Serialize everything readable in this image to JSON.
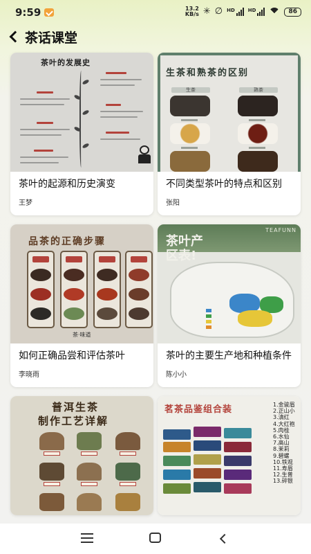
{
  "status_bar": {
    "time": "9:59",
    "net_speed_value": "13.2",
    "net_speed_unit": "KB/s",
    "signal_label_1": "HD",
    "signal_label_2": "HD",
    "battery": "86",
    "icons": [
      "app-notification-icon",
      "bluetooth-icon",
      "mute-icon",
      "signal-icon",
      "wifi-icon",
      "battery-icon"
    ]
  },
  "header": {
    "back_icon": "chevron-left-icon",
    "title": "茶话课堂"
  },
  "articles": [
    {
      "title": "茶叶的起源和历史演变",
      "author": "王梦",
      "thumb_text": "茶叶的发展史"
    },
    {
      "title": "不同类型茶叶的特点和区别",
      "author": "张阳",
      "thumb_text": "生茶和熟茶的区别",
      "thumb_labels": [
        "生茶",
        "熟茶"
      ]
    },
    {
      "title": "如何正确品尝和评估茶叶",
      "author": "李晓雨",
      "thumb_text": "品茶的正确步骤",
      "thumb_signature": "茶·味道"
    },
    {
      "title": "茶叶的主要生产地和种植条件",
      "author": "陈小小",
      "thumb_text": "茶叶产区表!",
      "thumb_brand": "TEAFUNN"
    },
    {
      "title": "",
      "author": "",
      "thumb_text_line1": "普洱生茶",
      "thumb_text_line2": "制作工艺详解"
    },
    {
      "title": "",
      "author": "",
      "thumb_text": "茗茶品鉴组合装",
      "thumb_list": [
        "1.金骏眉",
        "2.正山小",
        "3.滇红",
        "4.大红袍",
        "5.肉桂",
        "6.水仙",
        "7.高山",
        "8.茉莉",
        "9.碧螺",
        "10.铁观",
        "11.寿眉",
        "12.生普",
        "13.碎银"
      ]
    }
  ],
  "nav_bar": {
    "icons": [
      "menu-icon",
      "home-icon",
      "back-icon"
    ]
  }
}
